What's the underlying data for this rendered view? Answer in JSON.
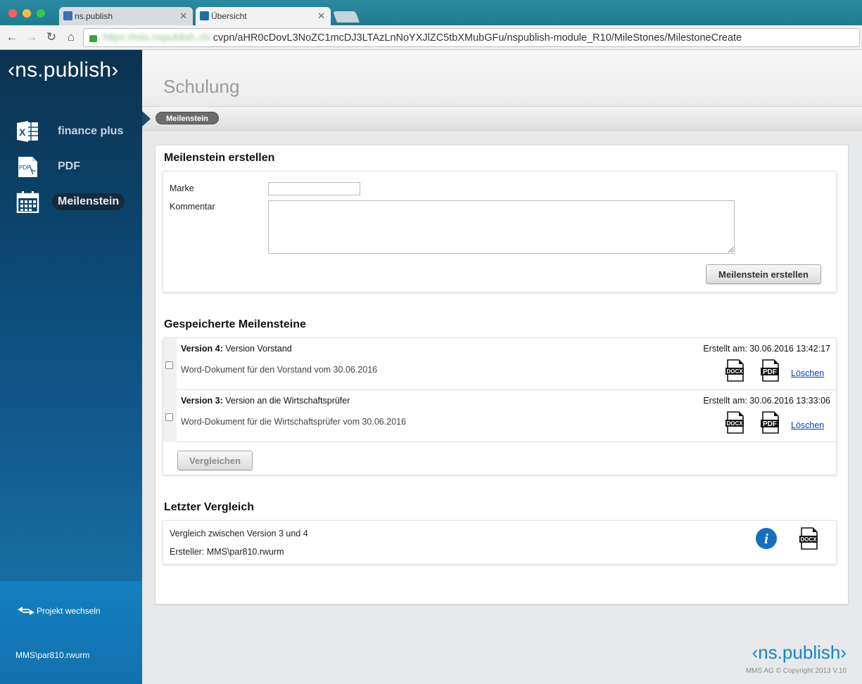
{
  "browser": {
    "tabs": [
      {
        "label": "ns.publish",
        "active": false
      },
      {
        "label": "Übersicht",
        "active": true
      }
    ],
    "url_host": "https://mis.nspublish.ch/",
    "url_path": "cvpn/aHR0cDovL3NoZC1mcDJ3LTAzLnNoYXJlZC5tbXMubGFu/nspublish-module_R10/MileStones/MilestoneCreate"
  },
  "sidebar": {
    "logo": "‹ns.publish›",
    "items": [
      {
        "label": "finance plus",
        "icon": "excel-icon",
        "active": false
      },
      {
        "label": "PDF",
        "icon": "pdf-icon",
        "active": false
      },
      {
        "label": "Meilenstein",
        "icon": "calendar-icon",
        "active": true
      }
    ],
    "switch_project": "Projekt wechseln",
    "user": "MMS\\par810.rwurm"
  },
  "header": {
    "title": "Schulung",
    "breadcrumb": "Meilenstein"
  },
  "create": {
    "title": "Meilenstein erstellen",
    "marke_label": "Marke",
    "marke_value": "",
    "kommentar_label": "Kommentar",
    "kommentar_value": "",
    "submit_label": "Meilenstein erstellen"
  },
  "saved": {
    "title": "Gespeicherte Meilensteine",
    "items": [
      {
        "version": "Version 4:",
        "name": "Version Vorstand",
        "created": "Erstellt am: 30.06.2016 13:42:17",
        "description": "Word-Dokument für den Vorstand vom 30.06.2016",
        "docx_label": "DOCX",
        "pdf_label": "PDF",
        "delete_label": "Löschen"
      },
      {
        "version": "Version 3:",
        "name": "Version an die Wirtschaftsprüfer",
        "created": "Erstellt am: 30.06.2016 13:33:06",
        "description": "Word-Dokument für die Wirtschaftsprüfer vom 30.06.2016",
        "docx_label": "DOCX",
        "pdf_label": "PDF",
        "delete_label": "Löschen"
      }
    ],
    "compare_label": "Vergleichen"
  },
  "last_compare": {
    "title": "Letzter Vergleich",
    "line1": "Vergleich zwischen Version 3 und 4",
    "line2": "Ersteller: MMS\\par810.rwurm",
    "info_label": "i",
    "docx_label": "DOCX"
  },
  "footer": {
    "logo": "‹ns.publish›",
    "copyright": "MMS AG © Copyright 2013 V.10"
  },
  "colors": {
    "sidebar_top": "#0b3250",
    "sidebar_bottom": "#1a7bb4",
    "accent": "#1a84c4",
    "link": "#0645ad"
  }
}
